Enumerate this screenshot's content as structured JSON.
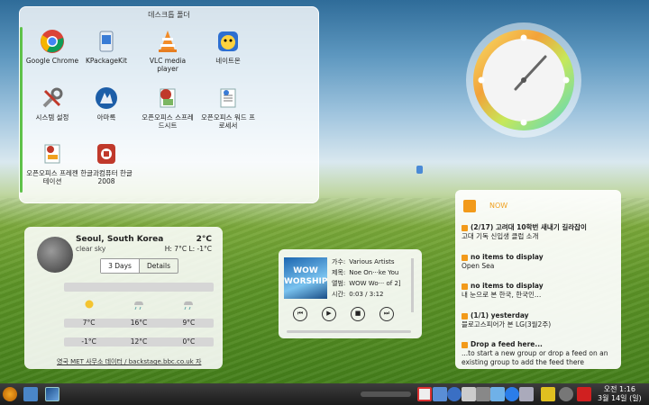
{
  "desktop": {
    "folder": {
      "title": "데스크톱 폴더",
      "icons": [
        {
          "label": "Google Chrome",
          "icon": "chrome-icon"
        },
        {
          "label": "KPackageKit",
          "icon": "package-icon"
        },
        {
          "label": "VLC media player",
          "icon": "vlc-icon"
        },
        {
          "label": "네이트온",
          "icon": "nateon-icon"
        },
        {
          "label": "시스템 설정",
          "icon": "system-settings-icon"
        },
        {
          "label": "아마록",
          "icon": "amarok-icon"
        },
        {
          "label": "오픈오피스 스프레드시트",
          "icon": "spreadsheet-icon"
        },
        {
          "label": "오픈오피스 워드 프로세서",
          "icon": "word-processor-icon"
        },
        {
          "label": "오픈오피스 프레젠테이션",
          "icon": "presentation-icon"
        },
        {
          "label": "한글과컴퓨터 한글 2008",
          "icon": "hwp-icon"
        }
      ]
    }
  },
  "weather": {
    "city": "Seoul, South Korea",
    "condition": "clear sky",
    "temp": "2°C",
    "high_low": "H: 7°C L: -1°C",
    "tabs": [
      "3 Days",
      "Details"
    ],
    "high_row": [
      "7°C",
      "16°C",
      "9°C"
    ],
    "low_row": [
      "-1°C",
      "12°C",
      "0°C"
    ],
    "credit": "영국 MET 사무소 데이터 / backstage.bbc.co.uk 자"
  },
  "player": {
    "album_art_text": "WOW WORSHIP",
    "artist_label": "가수:",
    "artist": "Various Artists",
    "title_label": "제목:",
    "title": "Noe On···ke You",
    "album_label": "앨범:",
    "album": "WOW Wo··· of 2]",
    "time_label": "시간:",
    "time": "0:03 / 3:12"
  },
  "feeds": {
    "title": "NOW",
    "items": [
      {
        "head": "(2/17) 고려대 10학번 새내기 길라잡이",
        "body": "고대 기독 신입생 클럽 소개"
      },
      {
        "head": "no items to display",
        "body": "Open Sea"
      },
      {
        "head": "no items to display",
        "body": "내 눈으로 본 한국, 한국인…"
      },
      {
        "head": "(1/1) yesterday",
        "body": "블로고스피어가 본 LG(3월2주)"
      },
      {
        "head": "Drop a feed here...",
        "body": "...to start a new group or drop a feed on an existing group to add the feed there"
      }
    ]
  },
  "taskbar": {
    "time": "오전 1:16",
    "date": "3월 14일 (일)"
  },
  "colors": {
    "accent_green": "#5fc24a",
    "feed_orange": "#f29a1a"
  }
}
